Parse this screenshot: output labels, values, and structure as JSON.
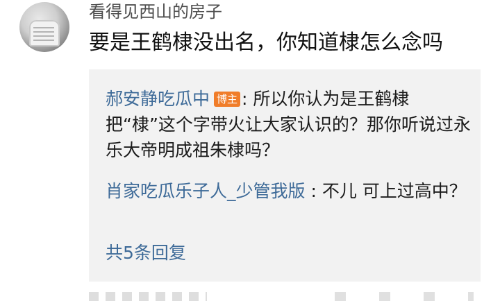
{
  "comment": {
    "username": "看得见西山的房子",
    "text": "要是王鹤棣没出名，你知道棣怎么念吗"
  },
  "replies": [
    {
      "name": "郝安静吃瓜中",
      "badge": "博主",
      "separator": ": ",
      "text": "所以你认为是王鹤棣把“棣”这个字带火让大家认识的？那你听说过永乐大帝明成祖朱棣吗？"
    },
    {
      "name": "肖家吃瓜乐子人_少管我版",
      "separator": " : ",
      "text": "不儿 可上过高中？"
    }
  ],
  "more_replies": "共5条回复",
  "colors": {
    "link": "#3d6a98",
    "badge": "#f07d2a",
    "reply_bg": "#f2f2f2"
  }
}
